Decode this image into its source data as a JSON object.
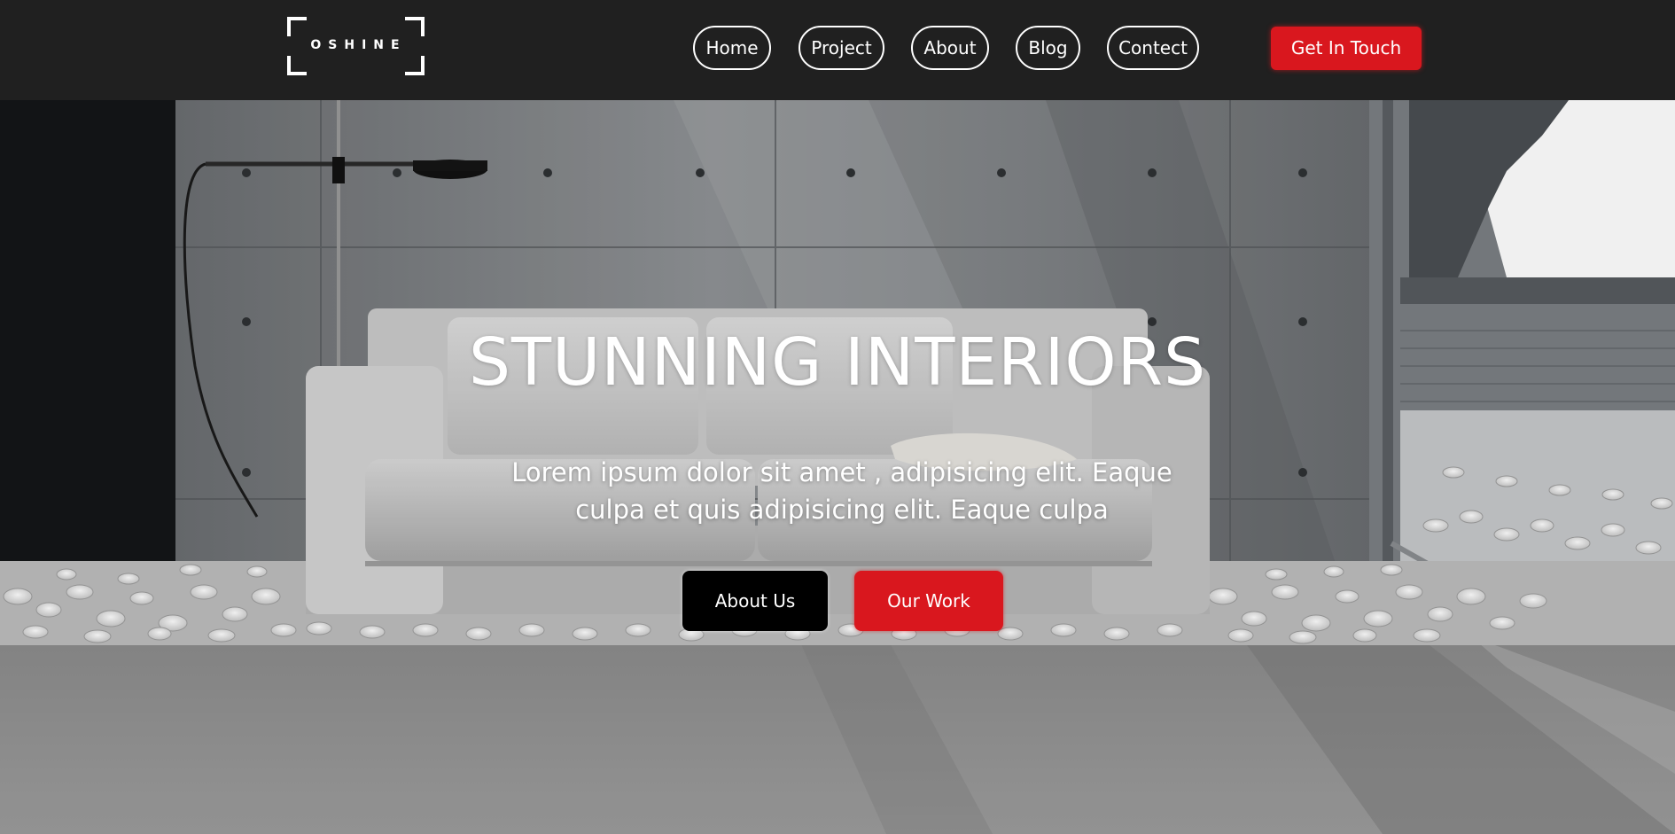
{
  "header": {
    "logo_text": "OSHINE",
    "nav": [
      {
        "label": "Home"
      },
      {
        "label": "Project"
      },
      {
        "label": "About"
      },
      {
        "label": "Blog"
      },
      {
        "label": "Contect"
      }
    ],
    "cta_label": "Get In Touch"
  },
  "hero": {
    "title": "STUNNING INTERIORS",
    "subtitle": "Lorem ipsum dolor sit amet , adipisicing elit. Eaque culpa et quis adipisicing elit. Eaque culpa",
    "primary_button": "About Us",
    "secondary_button": "Our Work",
    "background_description": "photo-of-grey-sofa-in-concrete-room"
  },
  "colors": {
    "header_bg": "#202020",
    "accent_red": "#d9171e",
    "text": "#ffffff",
    "dark_button": "#000000"
  }
}
